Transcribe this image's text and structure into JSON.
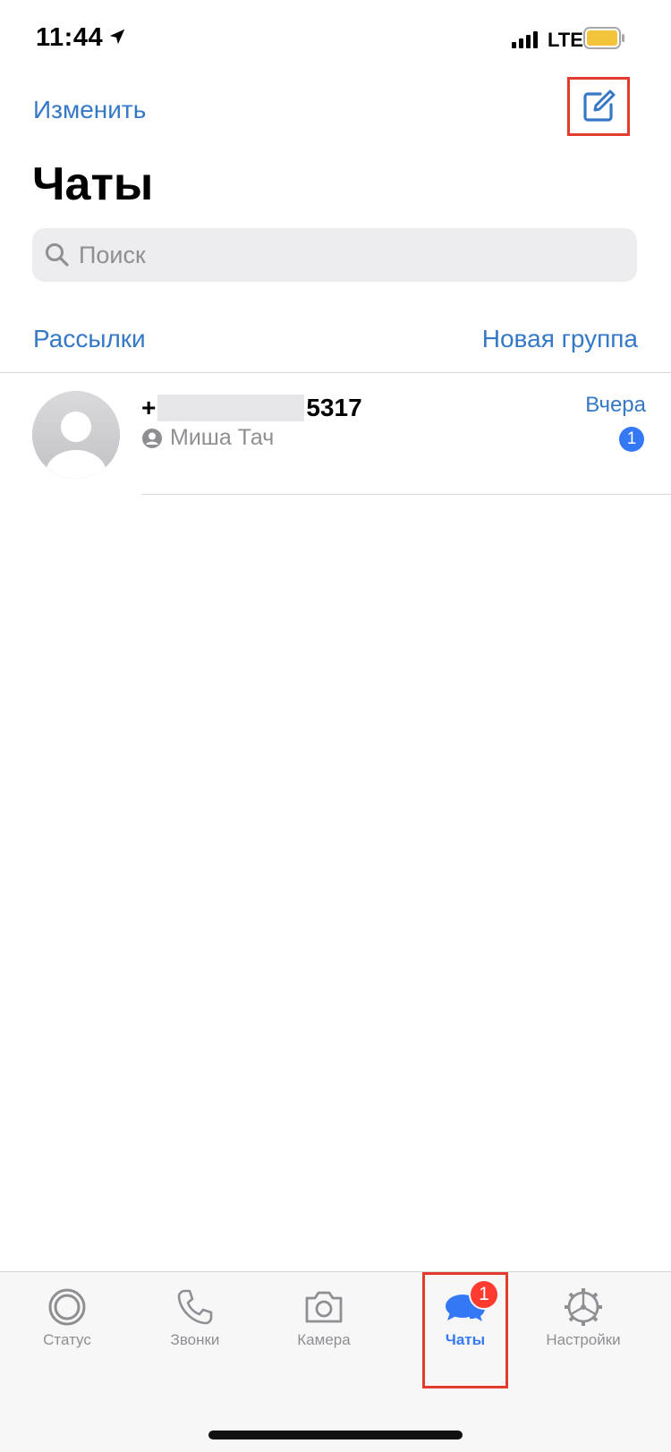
{
  "status_bar": {
    "time": "11:44",
    "network": "LTE",
    "battery_color": "#f3c33b"
  },
  "header": {
    "edit_label": "Изменить",
    "title": "Чаты",
    "compose_icon": "compose-icon"
  },
  "search": {
    "placeholder": "Поиск"
  },
  "links": {
    "broadcast": "Рассылки",
    "new_group": "Новая группа"
  },
  "chats": [
    {
      "name_prefix": "+",
      "name_suffix": "5317",
      "sender": "Миша Тач",
      "time": "Вчера",
      "unread": "1"
    }
  ],
  "tabs": [
    {
      "label": "Статус",
      "icon": "status-icon"
    },
    {
      "label": "Звонки",
      "icon": "phone-icon"
    },
    {
      "label": "Камера",
      "icon": "camera-icon"
    },
    {
      "label": "Чаты",
      "icon": "chat-bubbles-icon",
      "badge": "1"
    },
    {
      "label": "Настройки",
      "icon": "gear-icon"
    }
  ],
  "colors": {
    "accent": "#3478c6",
    "active_tab": "#3478f6",
    "badge": "#ff3b30",
    "highlight_frame": "#e53b2c"
  }
}
